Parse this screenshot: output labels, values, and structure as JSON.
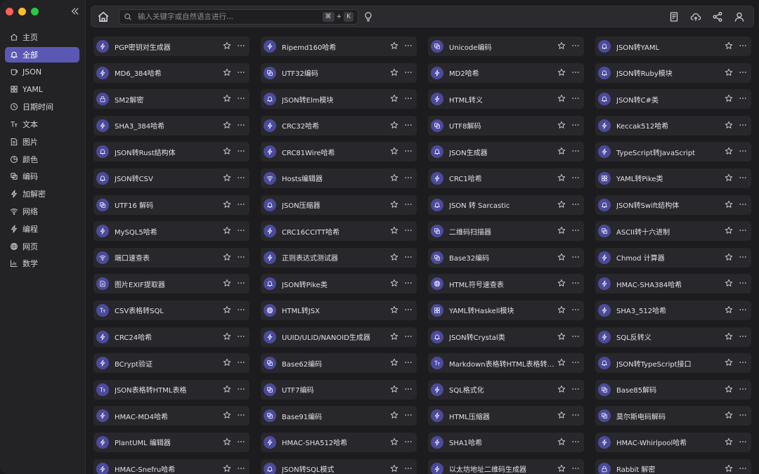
{
  "sidebar": {
    "items": [
      {
        "label": "主页",
        "icon": "home-icon",
        "active": false
      },
      {
        "label": "全部",
        "icon": "bell-icon",
        "active": true
      },
      {
        "label": "JSON",
        "icon": "json-icon",
        "active": false
      },
      {
        "label": "YAML",
        "icon": "grid-icon",
        "active": false
      },
      {
        "label": "日期时间",
        "icon": "clock-icon",
        "active": false
      },
      {
        "label": "文本",
        "icon": "text-icon",
        "active": false
      },
      {
        "label": "图片",
        "icon": "image-icon",
        "active": false
      },
      {
        "label": "颜色",
        "icon": "palette-icon",
        "active": false
      },
      {
        "label": "编码",
        "icon": "copy-icon",
        "active": false
      },
      {
        "label": "加解密",
        "icon": "bolt-icon",
        "active": false
      },
      {
        "label": "网络",
        "icon": "wifi-icon",
        "active": false
      },
      {
        "label": "编程",
        "icon": "bolt-icon",
        "active": false
      },
      {
        "label": "网页",
        "icon": "globe-icon",
        "active": false
      },
      {
        "label": "数学",
        "icon": "chart-icon",
        "active": false
      }
    ]
  },
  "search": {
    "placeholder": "输入关键字或自然语言进行...",
    "shortcut_keys": [
      "⌘",
      "K"
    ],
    "shortcut_plus": "+"
  },
  "colors": {
    "accent": "#5b58b4",
    "icon_bg": "#4c4a9a",
    "card_bg": "#28282c",
    "background": "#1c1c1f"
  },
  "tools": [
    {
      "label": "PGP密钥对生成器",
      "icon": "bolt-icon"
    },
    {
      "label": "Ripemd160哈希",
      "icon": "bolt-icon"
    },
    {
      "label": "Unicode编码",
      "icon": "copy-icon"
    },
    {
      "label": "JSON转YAML",
      "icon": "bell-icon"
    },
    {
      "label": "MD6_384哈希",
      "icon": "bolt-icon"
    },
    {
      "label": "UTF32编码",
      "icon": "copy-icon"
    },
    {
      "label": "MD2哈希",
      "icon": "bolt-icon"
    },
    {
      "label": "JSON转Ruby模块",
      "icon": "bell-icon"
    },
    {
      "label": "SM2解密",
      "icon": "lock-icon"
    },
    {
      "label": "JSON转Elm模块",
      "icon": "bell-icon"
    },
    {
      "label": "HTML转义",
      "icon": "bolt-icon"
    },
    {
      "label": "JSON转C#类",
      "icon": "bell-icon"
    },
    {
      "label": "SHA3_384哈希",
      "icon": "bolt-icon"
    },
    {
      "label": "CRC32哈希",
      "icon": "bolt-icon"
    },
    {
      "label": "UTF8解码",
      "icon": "copy-icon"
    },
    {
      "label": "Keccak512哈希",
      "icon": "bolt-icon"
    },
    {
      "label": "JSON转Rust结构体",
      "icon": "bell-icon"
    },
    {
      "label": "CRC81Wire哈希",
      "icon": "bolt-icon"
    },
    {
      "label": "JSON生成器",
      "icon": "bell-icon"
    },
    {
      "label": "TypeScript转JavaScript",
      "icon": "bolt-icon"
    },
    {
      "label": "JSON转CSV",
      "icon": "bell-icon"
    },
    {
      "label": "Hosts编辑器",
      "icon": "wifi-icon"
    },
    {
      "label": "CRC1哈希",
      "icon": "bolt-icon"
    },
    {
      "label": "YAML转Pike类",
      "icon": "grid-icon"
    },
    {
      "label": "UTF16 解码",
      "icon": "copy-icon"
    },
    {
      "label": "JSON压缩器",
      "icon": "bell-icon"
    },
    {
      "label": "JSON 转 Sarcastic",
      "icon": "bell-icon"
    },
    {
      "label": "JSON转Swift结构体",
      "icon": "bell-icon"
    },
    {
      "label": "MySQL5哈希",
      "icon": "bolt-icon"
    },
    {
      "label": "CRC16CCITT哈希",
      "icon": "bolt-icon"
    },
    {
      "label": "二维码扫描器",
      "icon": "copy-icon"
    },
    {
      "label": "ASCII转十六进制",
      "icon": "copy-icon"
    },
    {
      "label": "端口速查表",
      "icon": "wifi-icon"
    },
    {
      "label": "正则表达式测试器",
      "icon": "bolt-icon"
    },
    {
      "label": "Base32编码",
      "icon": "copy-icon"
    },
    {
      "label": "Chmod 计算器",
      "icon": "bolt-icon"
    },
    {
      "label": "图片EXIF提取器",
      "icon": "image-icon"
    },
    {
      "label": "JSON转Pike类",
      "icon": "bell-icon"
    },
    {
      "label": "HTML符号速查表",
      "icon": "globe-icon"
    },
    {
      "label": "HMAC-SHA384哈希",
      "icon": "bolt-icon"
    },
    {
      "label": "CSV表格转SQL",
      "icon": "text-icon"
    },
    {
      "label": "HTML转JSX",
      "icon": "globe-icon"
    },
    {
      "label": "YAML转Haskell模块",
      "icon": "grid-icon"
    },
    {
      "label": "SHA3_512哈希",
      "icon": "bolt-icon"
    },
    {
      "label": "CRC24哈希",
      "icon": "bolt-icon"
    },
    {
      "label": "UUID/ULID/NANOID生成器",
      "icon": "bolt-icon"
    },
    {
      "label": "JSON转Crystal类",
      "icon": "bell-icon"
    },
    {
      "label": "SQL反转义",
      "icon": "bolt-icon"
    },
    {
      "label": "BCrypt验证",
      "icon": "bolt-icon"
    },
    {
      "label": "Base62编码",
      "icon": "copy-icon"
    },
    {
      "label": "Markdown表格转HTML表格转换器",
      "icon": "text-icon"
    },
    {
      "label": "JSON转TypeScript接口",
      "icon": "bell-icon"
    },
    {
      "label": "JSON表格转HTML表格",
      "icon": "text-icon"
    },
    {
      "label": "UTF7编码",
      "icon": "copy-icon"
    },
    {
      "label": "SQL格式化",
      "icon": "bolt-icon"
    },
    {
      "label": "Base85解码",
      "icon": "copy-icon"
    },
    {
      "label": "HMAC-MD4哈希",
      "icon": "bolt-icon"
    },
    {
      "label": "Base91编码",
      "icon": "copy-icon"
    },
    {
      "label": "HTML压缩器",
      "icon": "bolt-icon"
    },
    {
      "label": "莫尔斯电码解码",
      "icon": "copy-icon"
    },
    {
      "label": "PlantUML 编辑器",
      "icon": "bolt-icon"
    },
    {
      "label": "HMAC-SHA512哈希",
      "icon": "bolt-icon"
    },
    {
      "label": "SHA1哈希",
      "icon": "bolt-icon"
    },
    {
      "label": "HMAC-Whirlpool哈希",
      "icon": "bolt-icon"
    },
    {
      "label": "HMAC-Snefru哈希",
      "icon": "bolt-icon"
    },
    {
      "label": "JSON转SQL模式",
      "icon": "bell-icon"
    },
    {
      "label": "以太坊地址二维码生成器",
      "icon": "bolt-icon"
    },
    {
      "label": "Rabbit 解密",
      "icon": "lock-icon"
    }
  ]
}
